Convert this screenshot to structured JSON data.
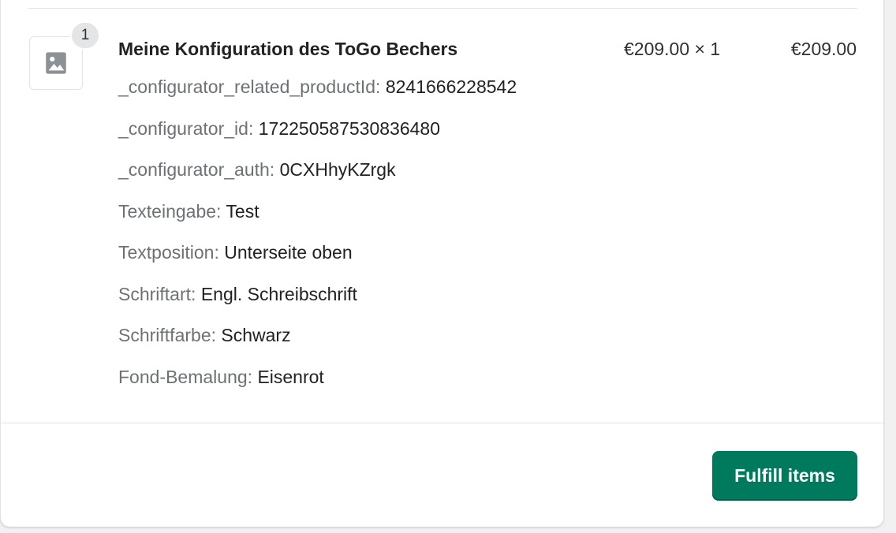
{
  "line_item": {
    "quantity_badge": "1",
    "image_icon": "image-placeholder-icon",
    "title": "Meine Konfiguration des ToGo Bechers",
    "unit_price": "€209.00 × 1",
    "total": "€209.00",
    "properties": [
      {
        "key": "_configurator_related_productId:",
        "value": "8241666228542"
      },
      {
        "key": "_configurator_id:",
        "value": "172250587530836480"
      },
      {
        "key": "_configurator_auth:",
        "value": "0CXHhyKZrgk"
      },
      {
        "key": "Texteingabe:",
        "value": "Test"
      },
      {
        "key": "Textposition:",
        "value": "Unterseite oben"
      },
      {
        "key": "Schriftart:",
        "value": "Engl. Schreibschrift"
      },
      {
        "key": "Schriftfarbe:",
        "value": "Schwarz"
      },
      {
        "key": "Fond-Bemalung:",
        "value": "Eisenrot"
      }
    ]
  },
  "footer": {
    "fulfill_label": "Fulfill items"
  },
  "colors": {
    "primary_button": "#007a5c",
    "muted_text": "#6d7175"
  }
}
